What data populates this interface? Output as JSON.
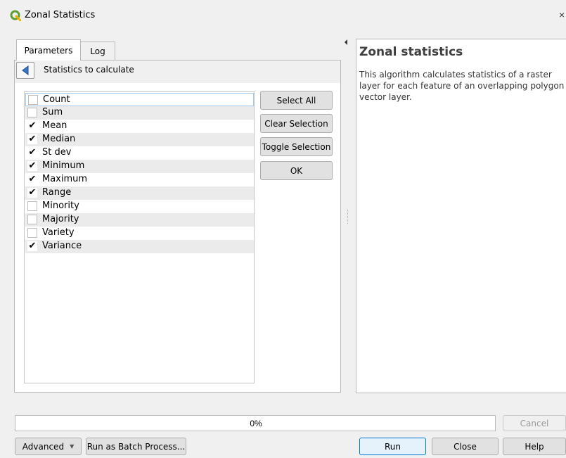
{
  "window": {
    "title": "Zonal Statistics",
    "close_glyph": "×",
    "icon": "qgis-logo-icon",
    "accent": "#5c9e31"
  },
  "tabs": [
    {
      "label": "Parameters",
      "active": true
    },
    {
      "label": "Log",
      "active": false
    }
  ],
  "panel": {
    "header": "Statistics to calculate",
    "back_icon": "triangle-left-icon"
  },
  "statistics": [
    {
      "label": "Count",
      "checked": false
    },
    {
      "label": "Sum",
      "checked": false
    },
    {
      "label": "Mean",
      "checked": true
    },
    {
      "label": "Median",
      "checked": true
    },
    {
      "label": "St dev",
      "checked": true
    },
    {
      "label": "Minimum",
      "checked": true
    },
    {
      "label": "Maximum",
      "checked": true
    },
    {
      "label": "Range",
      "checked": true
    },
    {
      "label": "Minority",
      "checked": false
    },
    {
      "label": "Majority",
      "checked": false
    },
    {
      "label": "Variety",
      "checked": false
    },
    {
      "label": "Variance",
      "checked": true
    }
  ],
  "check_glyph": "✔",
  "actions": {
    "select_all": "Select All",
    "clear_selection": "Clear Selection",
    "toggle_selection": "Toggle Selection",
    "ok": "OK"
  },
  "help": {
    "title": "Zonal statistics",
    "body": "This algorithm calculates statistics of a raster layer for each feature of an overlapping polygon vector layer."
  },
  "progress": {
    "value": 0,
    "text": "0%"
  },
  "buttons": {
    "cancel": "Cancel",
    "advanced": "Advanced",
    "advanced_caret": "▼",
    "batch": "Run as Batch Process...",
    "run": "Run",
    "close": "Close",
    "help": "Help"
  }
}
